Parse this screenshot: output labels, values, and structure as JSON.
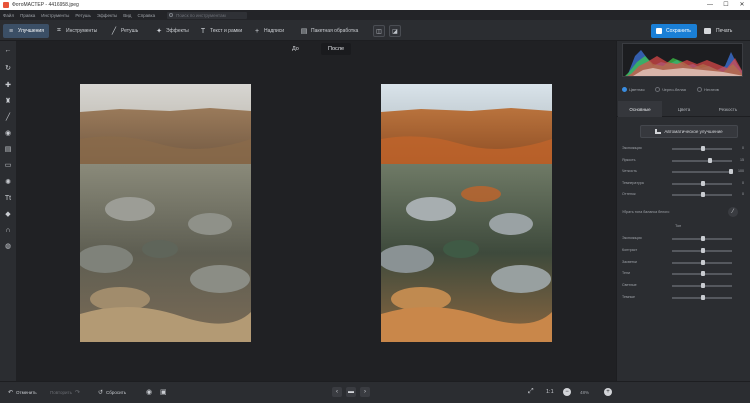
{
  "window": {
    "title": "ФотоМАСТЕР - 4416958.jpeg",
    "minimize": "—",
    "maximize": "☐",
    "close": "✕"
  },
  "menu": {
    "items": [
      "Файл",
      "Правка",
      "Инструменты",
      "Ретушь",
      "Эффекты",
      "Вид",
      "Справка"
    ],
    "search_placeholder": "Поиск по инструментам"
  },
  "toolbar": {
    "tabs": [
      {
        "label": "Улучшения",
        "icon": "sliders-icon",
        "active": true
      },
      {
        "label": "Инструменты",
        "icon": "crop-icon",
        "active": false
      },
      {
        "label": "Ретушь",
        "icon": "brush-icon",
        "active": false
      },
      {
        "label": "Эффекты",
        "icon": "magic-wand-icon",
        "active": false
      },
      {
        "label": "Текст и рамки",
        "icon": "text-icon",
        "active": false
      },
      {
        "label": "Надписи",
        "icon": "plus-icon",
        "active": false
      },
      {
        "label": "Пакетная обработка",
        "icon": "batch-icon",
        "active": false
      }
    ],
    "save_label": "Сохранить",
    "print_label": "Печать"
  },
  "compare": {
    "before_label": "До",
    "after_label": "После"
  },
  "right_panel": {
    "view_modes": [
      {
        "label": "Цветная",
        "selected": true
      },
      {
        "label": "Черно-белая",
        "selected": false
      },
      {
        "label": "Негатив",
        "selected": false
      }
    ],
    "tabs": [
      {
        "label": "Основные",
        "active": true
      },
      {
        "label": "Цвета",
        "active": false
      },
      {
        "label": "Резкость",
        "active": false
      }
    ],
    "auto_button": "Автоматическое улучшение",
    "sliders_top": [
      {
        "label": "Экспозиция",
        "value": "0",
        "pos": 0.5
      },
      {
        "label": "Яркость",
        "value": "15",
        "pos": 0.62
      },
      {
        "label": "Четкость",
        "value": "100",
        "pos": 0.98
      },
      {
        "label": "Температура",
        "value": "0",
        "pos": 0.5
      },
      {
        "label": "Оттенок",
        "value": "0",
        "pos": 0.5
      }
    ],
    "white_balance_label": "Убрать тона баланса белого",
    "tone_heading": "Тон",
    "sliders_tone": [
      {
        "label": "Экспозиция",
        "value": "",
        "pos": 0.5
      },
      {
        "label": "Контраст",
        "value": "",
        "pos": 0.5
      },
      {
        "label": "Засветки",
        "value": "",
        "pos": 0.5
      },
      {
        "label": "Тени",
        "value": "",
        "pos": 0.5
      },
      {
        "label": "Светлые",
        "value": "",
        "pos": 0.5
      },
      {
        "label": "Темные",
        "value": "",
        "pos": 0.5
      }
    ]
  },
  "bottom": {
    "undo_label": "Отменить",
    "redo_label": "Повторить",
    "reset_label": "Сбросить",
    "zoom_ratio": "1:1",
    "zoom_percent": "48%",
    "minus": "−",
    "plus": "+",
    "prev": "‹",
    "next": "›"
  },
  "left_tools": [
    "back-arrow-icon",
    "rotate-icon",
    "heal-icon",
    "stamp-icon",
    "brush-icon",
    "radial-icon",
    "gradient-icon",
    "frame-icon",
    "sun-icon",
    "text-icon",
    "fill-icon",
    "magnet-icon",
    "globe-icon"
  ]
}
